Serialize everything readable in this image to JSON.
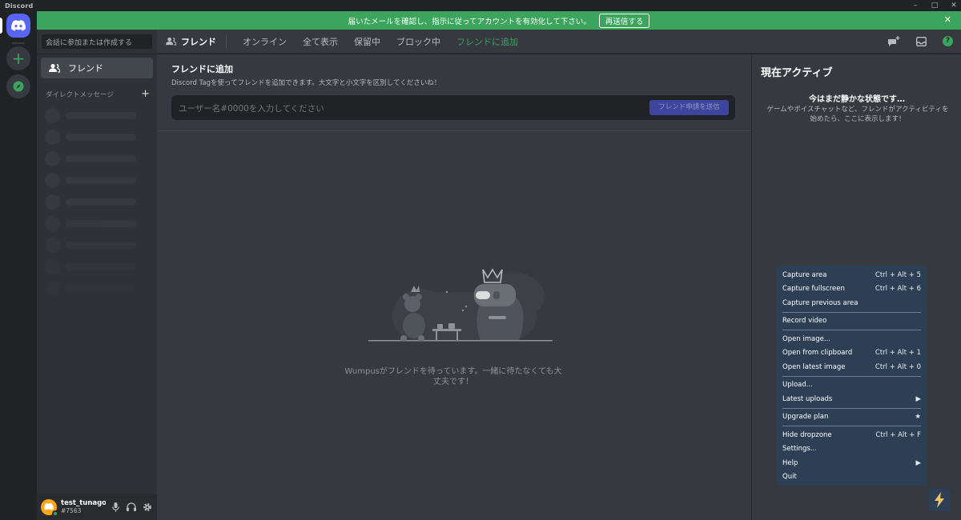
{
  "window": {
    "title": "Discord",
    "controls": [
      "–",
      "□",
      "✕"
    ]
  },
  "banner": {
    "message": "届いたメールを確認し、指示に従ってアカウントを有効化して下さい。",
    "resend_label": "再送信する",
    "close": "✕"
  },
  "sidebar": {
    "search_placeholder": "会話に参加または作成する",
    "friends_label": "フレンド",
    "dm_header": "ダイレクトメッセージ",
    "dm_add": "+"
  },
  "user": {
    "name": "test_tunago...",
    "tag": "#7563"
  },
  "topnav": {
    "title": "フレンド",
    "tabs": [
      "オンライン",
      "全て表示",
      "保留中",
      "ブロック中",
      "フレンドに追加"
    ]
  },
  "add_friend": {
    "title": "フレンドに追加",
    "description": "Discord Tagを使ってフレンドを追加できます。大文字と小文字を区別してくださいね！",
    "input_placeholder": "ユーザー名#0000を入力してください",
    "send_label": "フレンド申請を送信"
  },
  "empty_state": {
    "text": "Wumpusがフレンドを待っています。一緒に待たなくても大丈夫です！"
  },
  "active_now": {
    "title": "現在アクティブ",
    "quiet": "今はまだ静かな状態です…",
    "description": "ゲームやボイスチャットなど、フレンドがアクティビティを始めたら、ここに表示します！"
  },
  "context_menu": {
    "items": [
      {
        "label": "Capture area",
        "shortcut": "Ctrl + Alt + 5"
      },
      {
        "label": "Capture fullscreen",
        "shortcut": "Ctrl + Alt + 6"
      },
      {
        "label": "Capture previous area",
        "shortcut": ""
      },
      {
        "label": "Record video",
        "shortcut": ""
      },
      {
        "label": "Open image...",
        "shortcut": ""
      },
      {
        "label": "Open from clipboard",
        "shortcut": "Ctrl + Alt + 1"
      },
      {
        "label": "Open latest image",
        "shortcut": "Ctrl + Alt + 0"
      },
      {
        "label": "Upload...",
        "shortcut": ""
      },
      {
        "label": "Latest uploads",
        "shortcut": "▶"
      },
      {
        "label": "Upgrade plan",
        "shortcut": "★"
      },
      {
        "label": "Hide dropzone",
        "shortcut": "Ctrl + Alt + F"
      },
      {
        "label": "Settings...",
        "shortcut": ""
      },
      {
        "label": "Help",
        "shortcut": "▶"
      },
      {
        "label": "Quit",
        "shortcut": ""
      }
    ]
  },
  "colors": {
    "blurple": "#5865f2",
    "green": "#3ba55d",
    "menu_bg": "#2c3f54"
  }
}
